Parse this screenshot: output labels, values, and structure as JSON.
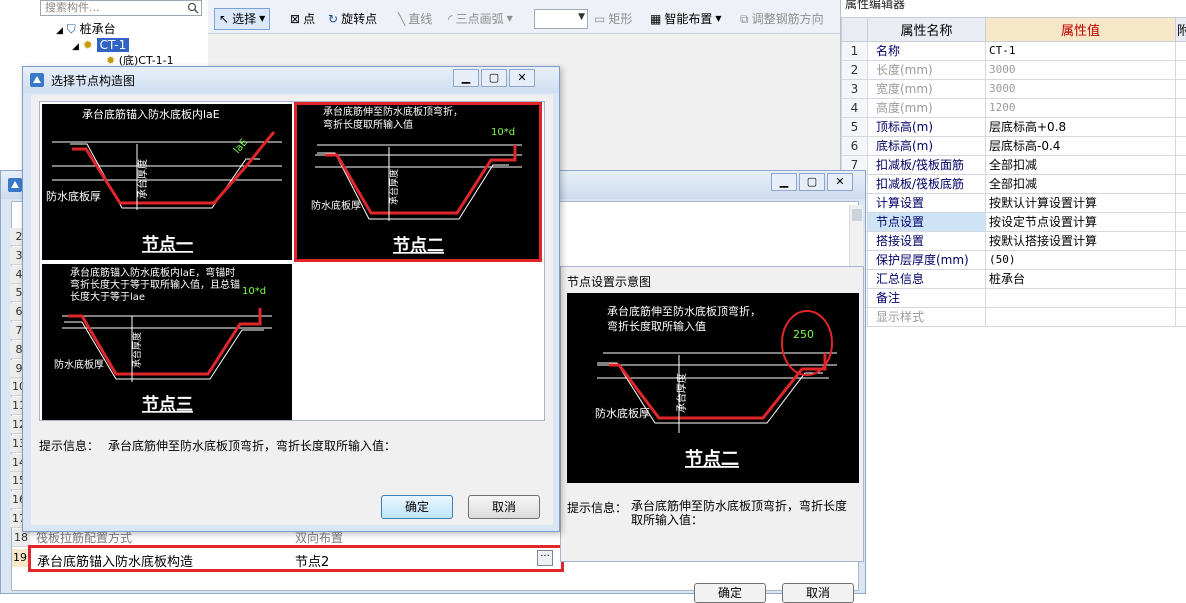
{
  "tree": {
    "search_placeholder": "搜索构件...",
    "root": "桩承台",
    "selected": "CT-1",
    "child": "(底)CT-1-1"
  },
  "toolbar": {
    "select": "选择",
    "point": "点",
    "rotate_point": "旋转点",
    "line": "直线",
    "arc": "三点画弧",
    "rect": "矩形",
    "smart_layout": "智能布置",
    "adjust_rebar": "调整钢筋方向"
  },
  "props": {
    "title": "属性编辑器",
    "col_name": "属性名称",
    "col_value": "属性值",
    "col_extra": "附",
    "rows": [
      {
        "n": "1",
        "name": "名称",
        "value": "CT-1"
      },
      {
        "n": "2",
        "name": "长度(mm)",
        "value": "3000"
      },
      {
        "n": "3",
        "name": "宽度(mm)",
        "value": "3000"
      },
      {
        "n": "4",
        "name": "高度(mm)",
        "value": "1200"
      },
      {
        "n": "5",
        "name": "顶标高(m)",
        "value": "层底标高+0.8"
      },
      {
        "n": "6",
        "name": "底标高(m)",
        "value": "层底标高-0.4"
      },
      {
        "n": "7",
        "name": "扣减板/筏板面筋",
        "value": "全部扣减"
      },
      {
        "n": "8",
        "name": "扣减板/筏板底筋",
        "value": "全部扣减"
      },
      {
        "n": "9",
        "name": "计算设置",
        "value": "按默认计算设置计算"
      },
      {
        "n": "10",
        "name": "节点设置",
        "value": "按设定节点设置计算"
      },
      {
        "n": "11",
        "name": "搭接设置",
        "value": "按默认搭接设置计算"
      },
      {
        "n": "12",
        "name": "保护层厚度(mm)",
        "value": "(50)"
      },
      {
        "n": "13",
        "name": "汇总信息",
        "value": "桩承台"
      },
      {
        "n": "14",
        "name": "备注",
        "value": ""
      },
      {
        "n": "15",
        "name": "显示样式",
        "value": ""
      }
    ]
  },
  "back_dialog": {
    "row18_num": "18",
    "row18_name": "筏板拉筋配置方式",
    "row18_value": "双向布置",
    "row19_num": "19",
    "row19_name": "承台底筋锚入防水底板构造",
    "row19_value": "节点2",
    "ellipsis": "···",
    "ok": "确定",
    "cancel": "取消",
    "row_numbers": [
      "2",
      "3",
      "4",
      "5",
      "6",
      "7",
      "8",
      "9",
      "10",
      "11",
      "12",
      "13",
      "14",
      "15",
      "16",
      "17"
    ]
  },
  "sample": {
    "title": "节点设置示意图",
    "text_line1": "承台底筋伸至防水底板顶弯折，",
    "text_line2": "弯折长度取所输入值",
    "dim_value": "250",
    "label_waterproof": "防水底板厚",
    "label_thickness": "承台厚度",
    "caption": "节点二",
    "hint_label": "提示信息：",
    "hint_text": "承台底筋伸至防水底板顶弯折，弯折长度取所输入值："
  },
  "front_dialog": {
    "title": "选择节点构造图",
    "node1": {
      "text_line1": "承台底筋锚入防水底板内laE",
      "dim": "laE",
      "label_waterproof": "防水底板厚",
      "label_thickness": "承台厚度",
      "caption": "节点一"
    },
    "node2": {
      "text_line1": "承台底筋伸至防水底板顶弯折，",
      "text_line2": "弯折长度取所输入值",
      "dim": "10*d",
      "label_waterproof": "防水底板厚",
      "label_thickness": "承台厚度",
      "caption": "节点二"
    },
    "node3": {
      "text_line1": "承台底筋锚入防水底板内laE，弯锚时",
      "text_line2": "弯折长度大于等于取所输入值，且总锚",
      "text_line3": "长度大于等于lae",
      "dim": "10*d",
      "label_waterproof": "防水底板厚",
      "label_thickness": "承台厚度",
      "caption": "节点三"
    },
    "hint_label": "提示信息：",
    "hint_text": "承台底筋伸至防水底板顶弯折，弯折长度取所输入值：",
    "ok": "确定",
    "cancel": "取消"
  },
  "colors": {
    "rebar": "#e0262a",
    "highlight_border": "#e0262a",
    "selection_blue": "#3163c5"
  }
}
